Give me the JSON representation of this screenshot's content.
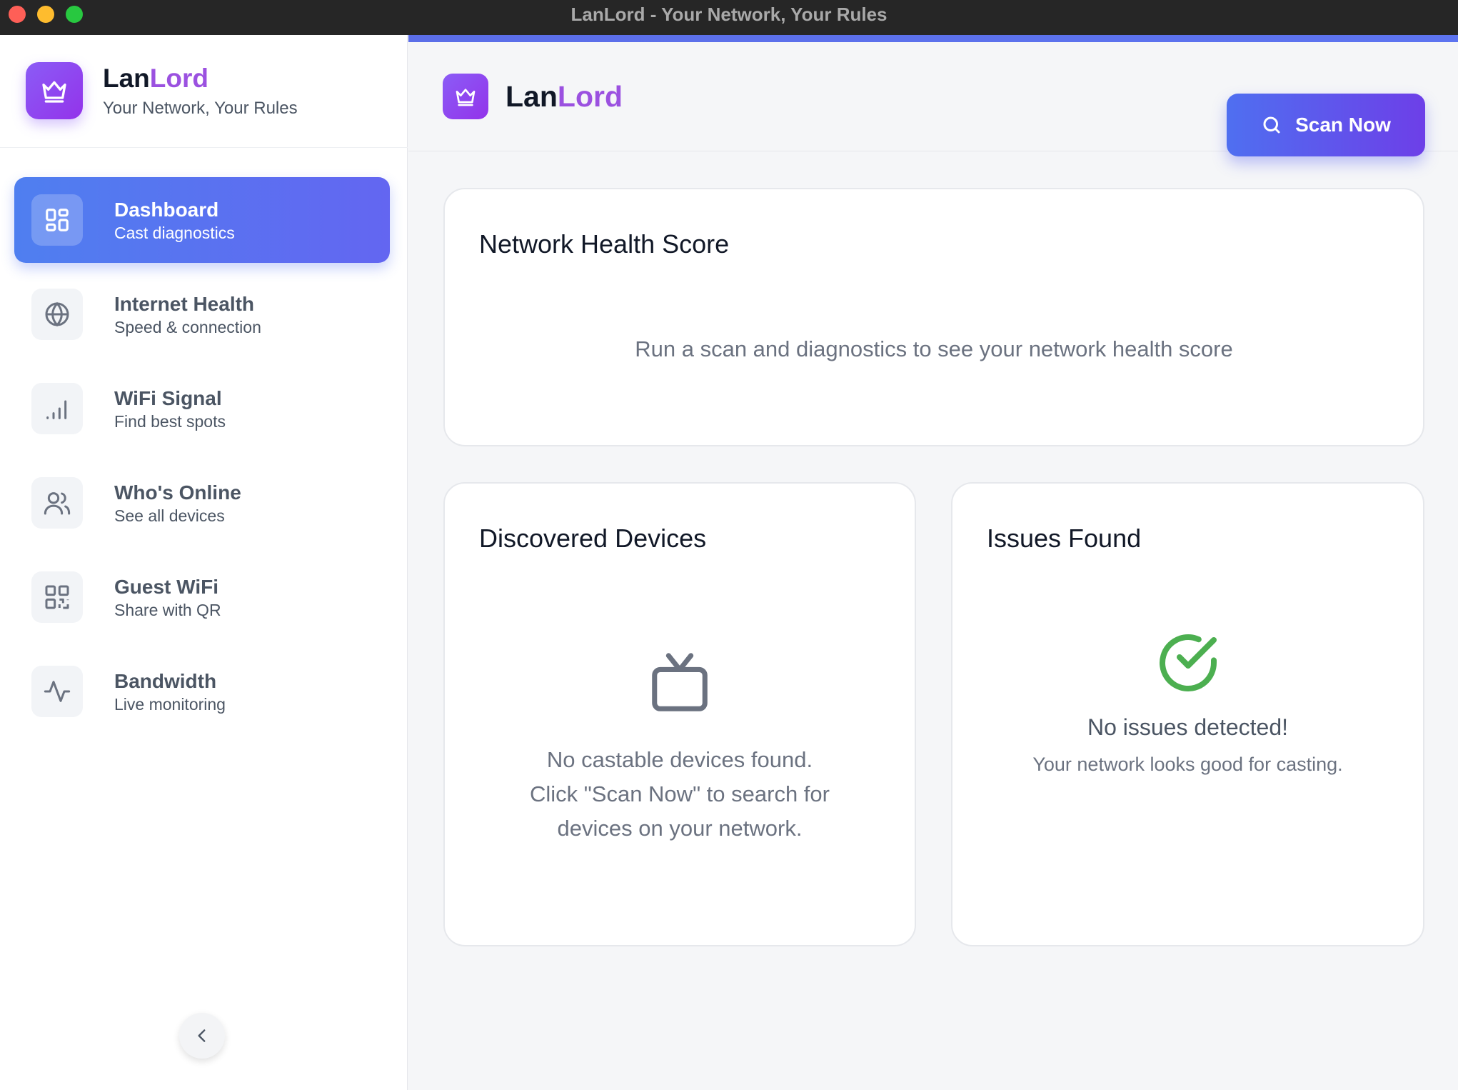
{
  "window": {
    "title": "LanLord - Your Network, Your Rules"
  },
  "brand": {
    "name_part1": "Lan",
    "name_part2": "Lord",
    "tagline": "Your Network, Your Rules",
    "accent_color": "#9b51e0",
    "logo_icon": "crown-icon"
  },
  "sidebar": {
    "items": [
      {
        "label": "Dashboard",
        "sub": "Cast diagnostics",
        "icon": "dashboard-grid-icon",
        "active": true
      },
      {
        "label": "Internet Health",
        "sub": "Speed & connection",
        "icon": "globe-icon",
        "active": false
      },
      {
        "label": "WiFi Signal",
        "sub": "Find best spots",
        "icon": "signal-bars-icon",
        "active": false
      },
      {
        "label": "Who's Online",
        "sub": "See all devices",
        "icon": "users-icon",
        "active": false
      },
      {
        "label": "Guest WiFi",
        "sub": "Share with QR",
        "icon": "qr-code-icon",
        "active": false
      },
      {
        "label": "Bandwidth",
        "sub": "Live monitoring",
        "icon": "activity-icon",
        "active": false
      }
    ],
    "collapse_icon": "chevron-left-icon"
  },
  "header": {
    "name_part1": "Lan",
    "name_part2": "Lord",
    "scan_button": "Scan Now",
    "scan_icon": "search-icon"
  },
  "cards": {
    "health": {
      "title": "Network Health Score",
      "message": "Run a scan and diagnostics to see your network health score"
    },
    "devices": {
      "title": "Discovered Devices",
      "icon": "tv-icon",
      "message_line1": "No castable devices found.",
      "message_line2": "Click \"Scan Now\" to search for",
      "message_line3": "devices on your network."
    },
    "issues": {
      "title": "Issues Found",
      "icon": "check-circle-icon",
      "status_color": "#4caf50",
      "message": "No issues detected!",
      "sub": "Your network looks good for casting."
    }
  }
}
